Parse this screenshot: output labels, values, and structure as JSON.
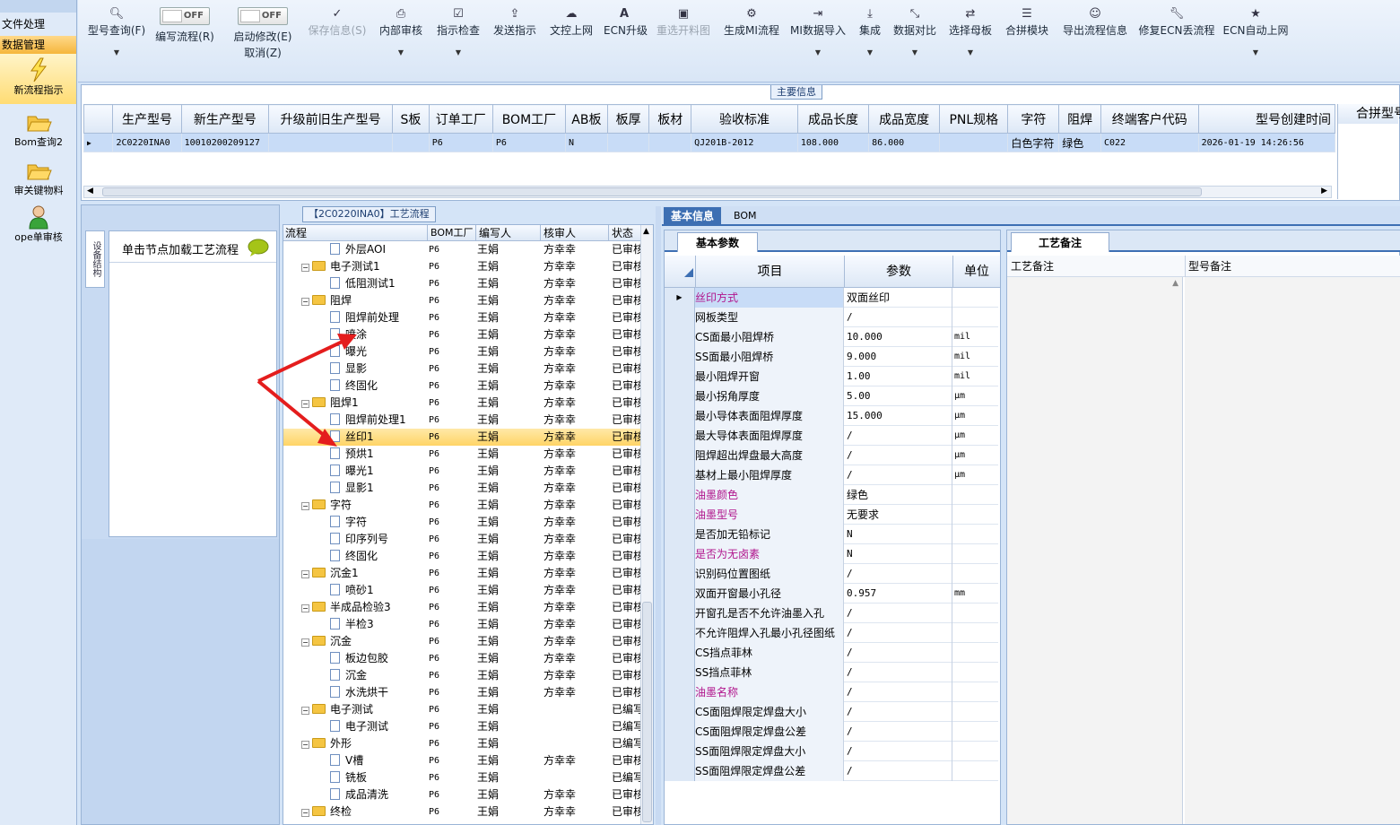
{
  "leftnav": {
    "file": "文件处理",
    "data_mgmt": "数据管理",
    "items": [
      "新流程指示",
      "Bom查询2",
      "审关键物料",
      "ope单审核"
    ]
  },
  "toolbar": {
    "buttons": [
      "型号查询(F)",
      "编写流程(R)",
      "启动修改(E)",
      "取消(Z)",
      "保存信息(S)",
      "内部审核",
      "指示检查",
      "发送指示",
      "文控上网",
      "ECN升级",
      "重选开料图",
      "生成MI流程",
      "MI数据导入",
      "集成",
      "数据对比",
      "选择母板",
      "合拼模块",
      "导出流程信息",
      "修复ECN丢流程",
      "ECN自动上网"
    ],
    "toggle_off": "OFF"
  },
  "main_info": {
    "caption": "主要信息",
    "columns": [
      "生产型号",
      "新生产型号",
      "升级前旧生产型号",
      "S板",
      "订单工厂",
      "BOM工厂",
      "AB板",
      "板厚",
      "板材",
      "验收标准",
      "成品长度",
      "成品宽度",
      "PNL规格",
      "字符",
      "阻焊",
      "终端客户代码",
      "型号创建时间",
      "合拼型号"
    ],
    "row": [
      "2C0220INA0",
      "10010200209127",
      "",
      "",
      "P6",
      "P6",
      "N",
      "",
      "",
      "QJ201B-2012",
      "108.000",
      "86.000",
      "",
      "白色字符",
      "绿色",
      "C022",
      "2026-01-19 14:26:56"
    ]
  },
  "side_tab": "设备结构",
  "load_hint": "单击节点加载工艺流程",
  "flow_tab": "【2C0220INA0】工艺流程",
  "tree": {
    "columns": [
      "流程",
      "BOM工厂",
      "编写人",
      "核审人",
      "状态"
    ],
    "rows": [
      {
        "lvl": 2,
        "name": "外层AOI",
        "f": "P6",
        "w": "王娟",
        "r": "方幸幸",
        "s": "已审核"
      },
      {
        "lvl": 1,
        "name": "电子测试1",
        "f": "P6",
        "w": "王娟",
        "r": "方幸幸",
        "s": "已审核"
      },
      {
        "lvl": 2,
        "name": "低阻测试1",
        "f": "P6",
        "w": "王娟",
        "r": "方幸幸",
        "s": "已审核"
      },
      {
        "lvl": 1,
        "name": "阻焊",
        "f": "P6",
        "w": "王娟",
        "r": "方幸幸",
        "s": "已审核"
      },
      {
        "lvl": 2,
        "name": "阻焊前处理",
        "f": "P6",
        "w": "王娟",
        "r": "方幸幸",
        "s": "已审核"
      },
      {
        "lvl": 2,
        "name": "喷涂",
        "f": "P6",
        "w": "王娟",
        "r": "方幸幸",
        "s": "已审核"
      },
      {
        "lvl": 2,
        "name": "曝光",
        "f": "P6",
        "w": "王娟",
        "r": "方幸幸",
        "s": "已审核"
      },
      {
        "lvl": 2,
        "name": "显影",
        "f": "P6",
        "w": "王娟",
        "r": "方幸幸",
        "s": "已审核"
      },
      {
        "lvl": 2,
        "name": "终固化",
        "f": "P6",
        "w": "王娟",
        "r": "方幸幸",
        "s": "已审核"
      },
      {
        "lvl": 1,
        "name": "阻焊1",
        "f": "P6",
        "w": "王娟",
        "r": "方幸幸",
        "s": "已审核"
      },
      {
        "lvl": 2,
        "name": "阻焊前处理1",
        "f": "P6",
        "w": "王娟",
        "r": "方幸幸",
        "s": "已审核"
      },
      {
        "lvl": 2,
        "name": "丝印1",
        "f": "P6",
        "w": "王娟",
        "r": "方幸幸",
        "s": "已审核",
        "sel": true
      },
      {
        "lvl": 2,
        "name": "预烘1",
        "f": "P6",
        "w": "王娟",
        "r": "方幸幸",
        "s": "已审核"
      },
      {
        "lvl": 2,
        "name": "曝光1",
        "f": "P6",
        "w": "王娟",
        "r": "方幸幸",
        "s": "已审核"
      },
      {
        "lvl": 2,
        "name": "显影1",
        "f": "P6",
        "w": "王娟",
        "r": "方幸幸",
        "s": "已审核"
      },
      {
        "lvl": 1,
        "name": "字符",
        "f": "P6",
        "w": "王娟",
        "r": "方幸幸",
        "s": "已审核"
      },
      {
        "lvl": 2,
        "name": "字符",
        "f": "P6",
        "w": "王娟",
        "r": "方幸幸",
        "s": "已审核"
      },
      {
        "lvl": 2,
        "name": "印序列号",
        "f": "P6",
        "w": "王娟",
        "r": "方幸幸",
        "s": "已审核"
      },
      {
        "lvl": 2,
        "name": "终固化",
        "f": "P6",
        "w": "王娟",
        "r": "方幸幸",
        "s": "已审核"
      },
      {
        "lvl": 1,
        "name": "沉金1",
        "f": "P6",
        "w": "王娟",
        "r": "方幸幸",
        "s": "已审核"
      },
      {
        "lvl": 2,
        "name": "喷砂1",
        "f": "P6",
        "w": "王娟",
        "r": "方幸幸",
        "s": "已审核"
      },
      {
        "lvl": 1,
        "name": "半成品检验3",
        "f": "P6",
        "w": "王娟",
        "r": "方幸幸",
        "s": "已审核"
      },
      {
        "lvl": 2,
        "name": "半检3",
        "f": "P6",
        "w": "王娟",
        "r": "方幸幸",
        "s": "已审核"
      },
      {
        "lvl": 1,
        "name": "沉金",
        "f": "P6",
        "w": "王娟",
        "r": "方幸幸",
        "s": "已审核"
      },
      {
        "lvl": 2,
        "name": "板边包胶",
        "f": "P6",
        "w": "王娟",
        "r": "方幸幸",
        "s": "已审核"
      },
      {
        "lvl": 2,
        "name": "沉金",
        "f": "P6",
        "w": "王娟",
        "r": "方幸幸",
        "s": "已审核"
      },
      {
        "lvl": 2,
        "name": "水洗烘干",
        "f": "P6",
        "w": "王娟",
        "r": "方幸幸",
        "s": "已审核"
      },
      {
        "lvl": 1,
        "name": "电子测试",
        "f": "P6",
        "w": "王娟",
        "r": "",
        "s": "已编写"
      },
      {
        "lvl": 2,
        "name": "电子测试",
        "f": "P6",
        "w": "王娟",
        "r": "",
        "s": "已编写"
      },
      {
        "lvl": 1,
        "name": "外形",
        "f": "P6",
        "w": "王娟",
        "r": "",
        "s": "已编写"
      },
      {
        "lvl": 2,
        "name": "V槽",
        "f": "P6",
        "w": "王娟",
        "r": "方幸幸",
        "s": "已审核"
      },
      {
        "lvl": 2,
        "name": "铣板",
        "f": "P6",
        "w": "王娟",
        "r": "",
        "s": "已编写"
      },
      {
        "lvl": 2,
        "name": "成品清洗",
        "f": "P6",
        "w": "王娟",
        "r": "方幸幸",
        "s": "已审核"
      },
      {
        "lvl": 1,
        "name": "终检",
        "f": "P6",
        "w": "王娟",
        "r": "方幸幸",
        "s": "已审核"
      }
    ]
  },
  "right_tabs": {
    "basic": "基本信息",
    "bom": "BOM"
  },
  "basic_params": {
    "tab": "基本参数",
    "columns": [
      "项目",
      "参数",
      "单位"
    ],
    "rows": [
      {
        "item": "丝印方式",
        "val": "双面丝印",
        "unit": "",
        "hl": true
      },
      {
        "item": "网板类型",
        "val": "/",
        "unit": ""
      },
      {
        "item": "CS面最小阻焊桥",
        "val": "10.000",
        "unit": "mil"
      },
      {
        "item": "SS面最小阻焊桥",
        "val": "9.000",
        "unit": "mil"
      },
      {
        "item": "最小阻焊开窗",
        "val": "1.00",
        "unit": "mil"
      },
      {
        "item": "最小拐角厚度",
        "val": "5.00",
        "unit": "μm"
      },
      {
        "item": "最小导体表面阻焊厚度",
        "val": "15.000",
        "unit": "μm"
      },
      {
        "item": "最大导体表面阻焊厚度",
        "val": "/",
        "unit": "μm"
      },
      {
        "item": "阻焊超出焊盘最大高度",
        "val": "/",
        "unit": "μm"
      },
      {
        "item": "基材上最小阻焊厚度",
        "val": "/",
        "unit": "μm"
      },
      {
        "item": "油墨颜色",
        "val": "绿色",
        "unit": "",
        "hl": true
      },
      {
        "item": "油墨型号",
        "val": "无要求",
        "unit": "",
        "hl": true
      },
      {
        "item": "是否加无铅标记",
        "val": "N",
        "unit": ""
      },
      {
        "item": "是否为无卤素",
        "val": "N",
        "unit": "",
        "hl": true
      },
      {
        "item": "识别码位置图纸",
        "val": "/",
        "unit": ""
      },
      {
        "item": "双面开窗最小孔径",
        "val": "0.957",
        "unit": "mm"
      },
      {
        "item": "开窗孔是否不允许油墨入孔",
        "val": "/",
        "unit": ""
      },
      {
        "item": "不允许阻焊入孔最小孔径图纸",
        "val": "/",
        "unit": ""
      },
      {
        "item": "CS挡点菲林",
        "val": "/",
        "unit": ""
      },
      {
        "item": "SS挡点菲林",
        "val": "/",
        "unit": ""
      },
      {
        "item": "油墨名称",
        "val": "/",
        "unit": "",
        "hl": true
      },
      {
        "item": "CS面阻焊限定焊盘大小",
        "val": "/",
        "unit": ""
      },
      {
        "item": "CS面阻焊限定焊盘公差",
        "val": "/",
        "unit": ""
      },
      {
        "item": "SS面阻焊限定焊盘大小",
        "val": "/",
        "unit": ""
      },
      {
        "item": "SS面阻焊限定焊盘公差",
        "val": "/",
        "unit": ""
      }
    ]
  },
  "remark": {
    "tab": "工艺备注",
    "columns": [
      "工艺备注",
      "型号备注"
    ]
  },
  "colors": {
    "accent": "#3d6fb3",
    "highlight_text": "#b0148c",
    "selected_row": "#ffd466",
    "arrow": "#e41d1d"
  }
}
